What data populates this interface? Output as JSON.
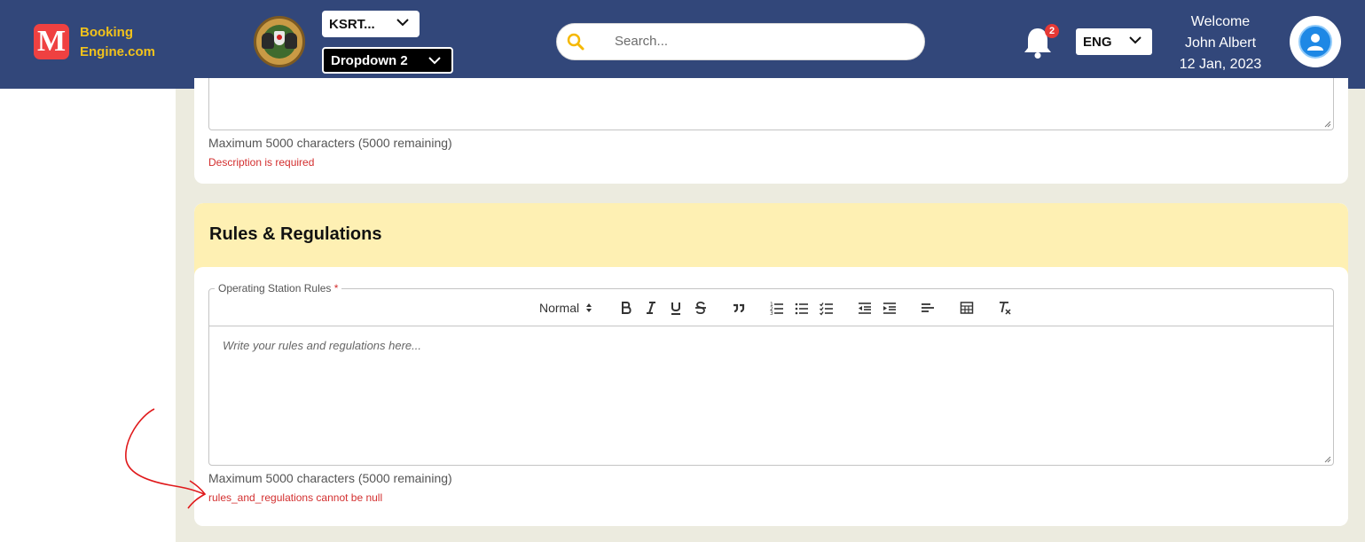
{
  "header": {
    "brand_line1": "Booking",
    "brand_line2": "Engine.com",
    "logo_letter": "M",
    "dropdown1": {
      "label": "KSRT..."
    },
    "dropdown2": {
      "label": "Dropdown 2"
    },
    "search": {
      "placeholder": "Search..."
    },
    "notifications": {
      "count": "2",
      "icon": "bell-icon"
    },
    "language": {
      "label": "ENG"
    },
    "user": {
      "welcome": "Welcome",
      "name": "John Albert",
      "date": "12 Jan, 2023"
    }
  },
  "description_section": {
    "helper": "Maximum 5000 characters (5000 remaining)",
    "error": "Description is required"
  },
  "rules_section": {
    "title": "Rules & Regulations",
    "field_label": "Operating Station Rules",
    "required_mark": "*",
    "format_select": "Normal",
    "placeholder": "Write your rules and regulations here...",
    "helper": "Maximum 5000 characters (5000 remaining)",
    "error": "rules_and_regulations cannot be null"
  },
  "colors": {
    "header_bg": "#32477a",
    "brand_text": "#f2c21b",
    "error": "#d32f2f",
    "section_header_bg": "#fef0b3",
    "content_bg": "#ecebdf"
  }
}
